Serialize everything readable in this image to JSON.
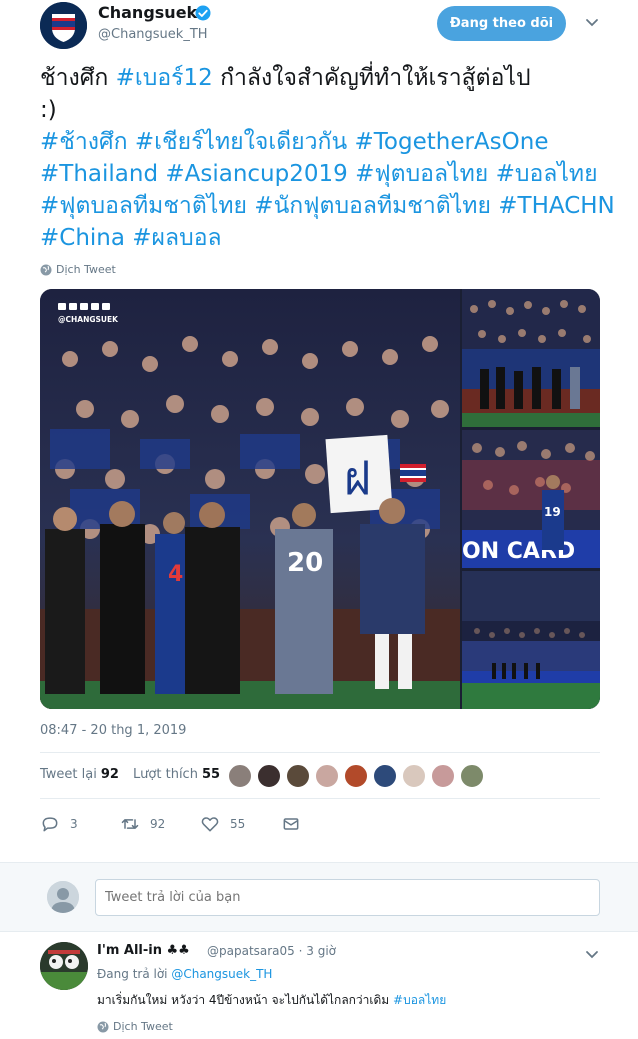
{
  "account": {
    "name": "Changsuek",
    "handle": "@Changsuek_TH",
    "follow_label": "Đang theo dõi"
  },
  "tweet": {
    "text_line1_a": "ช้างศึก ",
    "text_line1_hash": "#เบอร์12",
    "text_line1_b": " กำลังใจสำคัญที่ทำให้เราสู้ต่อไป",
    "text_line2": ":)",
    "hashtags": " #ช้างศึก #เชียร์ไทยใจเดียวกัน #TogetherAsOne #Thailand #Asiancup2019 #ฟุตบอลไทย #บอลไทย #ฟุตบอลทีมชาติไทย #นักฟุตบอลทีมชาติไทย #THACHN #China #ผลบอล",
    "translate_label": "Dịch Tweet",
    "timestamp": "08:47 - 20 thg 1, 2019"
  },
  "media": {
    "watermark": "@CHANGSUEK",
    "banner_text": "ON CARD",
    "jersey_left": "4",
    "jersey_center": "20",
    "jersey_right": "19",
    "sign_char": "ฝ"
  },
  "stats": {
    "retweets_label": "Tweet lại",
    "retweets": "92",
    "likes_label": "Lượt thích",
    "likes": "55"
  },
  "likers_colors": [
    "#8a7f7a",
    "#3b2f2f",
    "#5a4a3a",
    "#c9a7a0",
    "#b24a2a",
    "#2d4a7a",
    "#d9c8bd",
    "#c79a9a",
    "#7d8a6a"
  ],
  "actions": {
    "reply_count": "3",
    "retweet_count": "92",
    "like_count": "55"
  },
  "reply_box": {
    "placeholder": "Tweet trả lời của bạn"
  },
  "reply": {
    "name": "I'm All-in ♣♣",
    "handle": "@papatsara05 · 3 giờ",
    "replying_prefix": "Đang trả lời ",
    "replying_to": "@Changsuek_TH",
    "text": "มาเริ่มกันใหม่ หวังว่า 4ปีข้างหน้า จะไปกันได้ไกลกว่าเดิม ",
    "text_hash": "#บอลไทย",
    "translate_label": "Dịch Tweet"
  },
  "colors": {
    "link": "#1b95e0",
    "follow_button": "#4aa3df",
    "muted": "#657786"
  }
}
